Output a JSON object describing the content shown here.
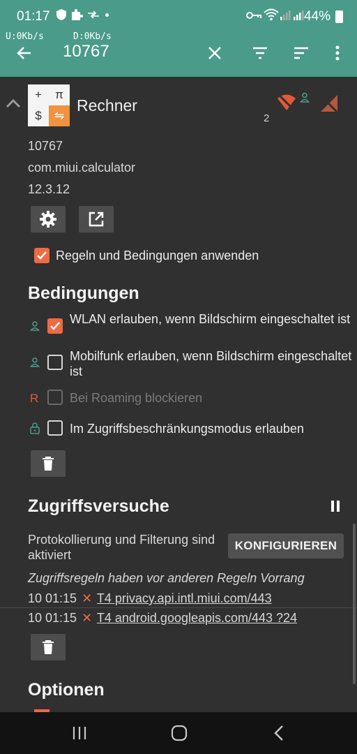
{
  "status": {
    "time": "01:17",
    "battery": "44%"
  },
  "speed": {
    "up": "U:0Kb/s",
    "down": "D:0Kb/s"
  },
  "appbar": {
    "title": "10767"
  },
  "app": {
    "name": "Rechner",
    "icon_glyphs": [
      "+",
      "π",
      "$",
      "⇋"
    ],
    "count": "2",
    "uid": "10767",
    "package": "com.miui.calculator",
    "version": "12.3.12"
  },
  "apply_rules": {
    "label": "Regeln und Bedingungen anwenden",
    "checked": true
  },
  "conditions": {
    "heading": "Bedingungen",
    "items": [
      {
        "label": "WLAN erlauben, wenn Bildschirm eingeschaltet ist",
        "checked": true,
        "icon": "person-icon"
      },
      {
        "label": "Mobilfunk erlauben, wenn Bildschirm eingeschaltet ist",
        "checked": false,
        "icon": "person-icon"
      },
      {
        "label": "Bei Roaming blockieren",
        "checked": false,
        "disabled": true,
        "icon": "R"
      },
      {
        "label": "Im Zugriffsbeschränkungsmodus erlauben",
        "checked": false,
        "icon": "lock-icon"
      }
    ]
  },
  "access": {
    "heading": "Zugriffsversuche",
    "logging_text": "Protokollierung und Filterung sind aktiviert",
    "configure_label": "KONFIGURIEREN",
    "priority_note": "Zugriffsregeln haben vor anderen Regeln Vorrang",
    "log": [
      {
        "time": "10 01:15",
        "addr": "T4 privacy.api.intl.miui.com/443"
      },
      {
        "time": "10 01:15",
        "addr": "T4 android.googleapis.com/443 ?24"
      }
    ]
  },
  "options": {
    "heading": "Optionen"
  },
  "colors": {
    "accent": "#4a9b89",
    "orange": "#ee6a43",
    "background": "#303030"
  }
}
